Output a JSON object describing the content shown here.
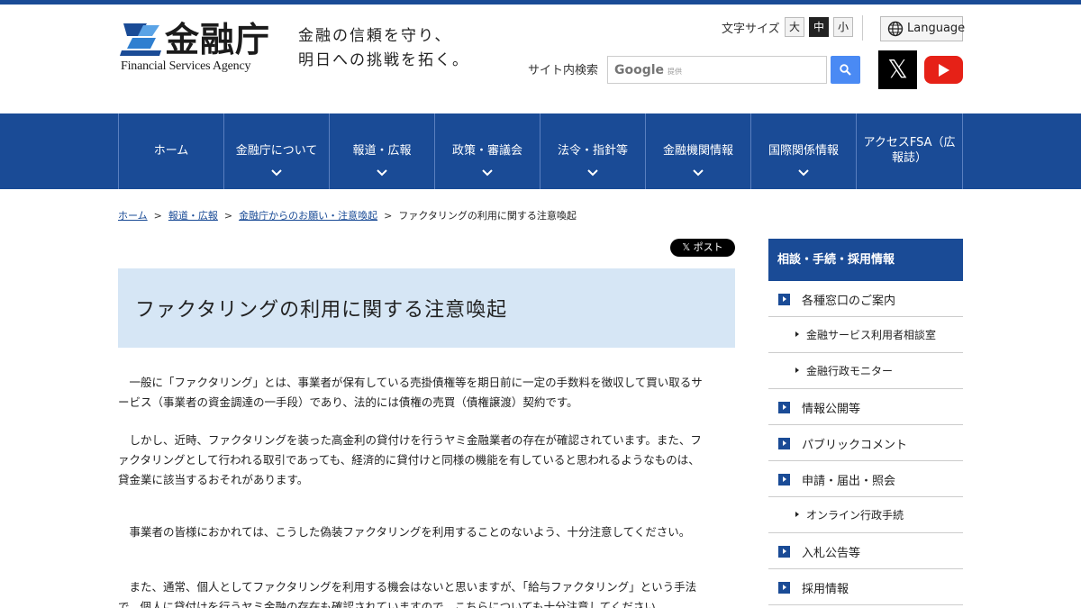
{
  "header": {
    "logo_jp": "金融庁",
    "logo_en": "Financial Services Agency",
    "slogan_line1": "金融の信頼を守り、",
    "slogan_line2": "明日への挑戦を拓く。",
    "font_size_label": "文字サイズ",
    "font_sizes": [
      "大",
      "中",
      "小"
    ],
    "font_size_active": "中",
    "language_label": "Language",
    "search_label": "サイト内検索",
    "search_placeholder": "Google",
    "search_placeholder_sub": "提供"
  },
  "nav": {
    "items": [
      {
        "label": "ホーム"
      },
      {
        "label": "金融庁について"
      },
      {
        "label": "報道・広報"
      },
      {
        "label": "政策・審議会"
      },
      {
        "label": "法令・指針等"
      },
      {
        "label": "金融機関情報"
      },
      {
        "label": "国際関係情報"
      },
      {
        "label_line1": "アクセスFSA（広",
        "label_line2": "報誌）"
      }
    ]
  },
  "breadcrumb": {
    "items": [
      "ホーム",
      "報道・広報",
      "金融庁からのお願い・注意喚起"
    ],
    "current": "ファクタリングの利用に関する注意喚起",
    "separator": ">"
  },
  "xpost_label": "ポスト",
  "page_title": "ファクタリングの利用に関する注意喚起",
  "body": {
    "p1_l1": "　一般に「ファクタリング」とは、事業者が保有している売掛債権等を期日前に一定の手数料を徴収して買い取るサ",
    "p1_l2": "ービス（事業者の資金調達の一手段）であり、法的には債権の売買（債権譲渡）契約です。",
    "p2_l1": "　しかし、近時、ファクタリングを装った高金利の貸付けを行うヤミ金融業者の存在が確認されています。また、フ",
    "p2_l2": "ァクタリングとして行われる取引であっても、経済的に貸付けと同様の機能を有していると思われるようなものは、",
    "p2_l3": "貸金業に該当するおそれがあります。",
    "p3_l1": "　事業者の皆様におかれては、こうした偽装ファクタリングを利用することのないよう、十分注意してください。",
    "p4_l1": "　また、通常、個人としてファクタリングを利用する機会はないと思いますが、「給与ファクタリング」という手法",
    "p4_l2": "で、個人に貸付けを行うヤミ金融の存在も確認されていますので、こちらについても十分注意してください。"
  },
  "sidebar": {
    "heading": "相談・手続・採用情報",
    "items": [
      {
        "label": "各種窓口のご案内",
        "type": "main"
      },
      {
        "label": "金融サービス利用者相談室",
        "type": "sub"
      },
      {
        "label": "金融行政モニター",
        "type": "sub"
      },
      {
        "label": "情報公開等",
        "type": "main"
      },
      {
        "label": "パブリックコメント",
        "type": "main"
      },
      {
        "label": "申請・届出・照会",
        "type": "main"
      },
      {
        "label": "オンライン行政手続",
        "type": "sub"
      },
      {
        "label": "入札公告等",
        "type": "main"
      },
      {
        "label": "採用情報",
        "type": "main"
      }
    ]
  },
  "colors": {
    "brand_blue": "#1a4b96",
    "title_bg": "#d6e6f5",
    "youtube_red": "#e62117",
    "google_blue": "#4a8af4"
  },
  "icons": [
    "logo-mark-icon",
    "globe-icon",
    "search-icon",
    "x-logo-icon",
    "youtube-icon",
    "chevron-down-icon",
    "square-arrow-icon",
    "triangle-bullet-icon"
  ]
}
